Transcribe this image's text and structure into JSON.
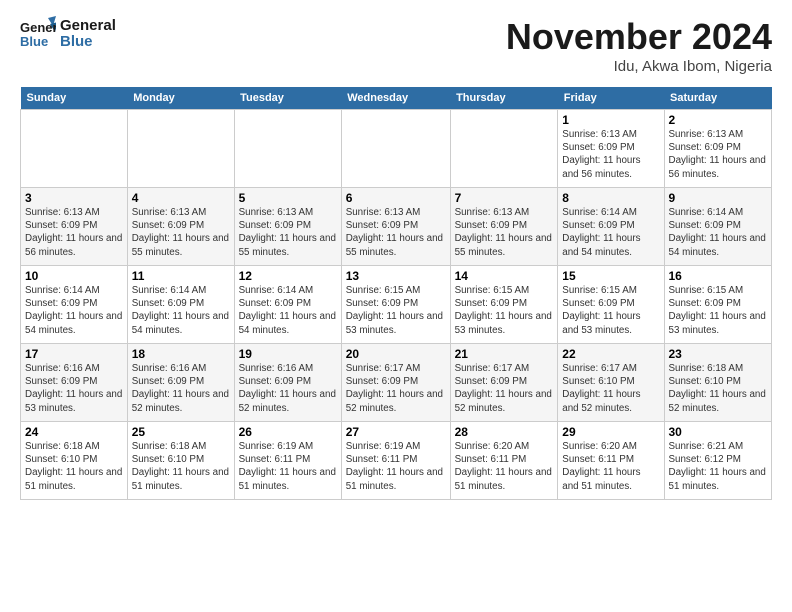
{
  "header": {
    "logo_line1": "General",
    "logo_line2": "Blue",
    "month_title": "November 2024",
    "location": "Idu, Akwa Ibom, Nigeria"
  },
  "days_of_week": [
    "Sunday",
    "Monday",
    "Tuesday",
    "Wednesday",
    "Thursday",
    "Friday",
    "Saturday"
  ],
  "weeks": [
    [
      {
        "day": "",
        "info": ""
      },
      {
        "day": "",
        "info": ""
      },
      {
        "day": "",
        "info": ""
      },
      {
        "day": "",
        "info": ""
      },
      {
        "day": "",
        "info": ""
      },
      {
        "day": "1",
        "info": "Sunrise: 6:13 AM\nSunset: 6:09 PM\nDaylight: 11 hours and 56 minutes."
      },
      {
        "day": "2",
        "info": "Sunrise: 6:13 AM\nSunset: 6:09 PM\nDaylight: 11 hours and 56 minutes."
      }
    ],
    [
      {
        "day": "3",
        "info": "Sunrise: 6:13 AM\nSunset: 6:09 PM\nDaylight: 11 hours and 56 minutes."
      },
      {
        "day": "4",
        "info": "Sunrise: 6:13 AM\nSunset: 6:09 PM\nDaylight: 11 hours and 55 minutes."
      },
      {
        "day": "5",
        "info": "Sunrise: 6:13 AM\nSunset: 6:09 PM\nDaylight: 11 hours and 55 minutes."
      },
      {
        "day": "6",
        "info": "Sunrise: 6:13 AM\nSunset: 6:09 PM\nDaylight: 11 hours and 55 minutes."
      },
      {
        "day": "7",
        "info": "Sunrise: 6:13 AM\nSunset: 6:09 PM\nDaylight: 11 hours and 55 minutes."
      },
      {
        "day": "8",
        "info": "Sunrise: 6:14 AM\nSunset: 6:09 PM\nDaylight: 11 hours and 54 minutes."
      },
      {
        "day": "9",
        "info": "Sunrise: 6:14 AM\nSunset: 6:09 PM\nDaylight: 11 hours and 54 minutes."
      }
    ],
    [
      {
        "day": "10",
        "info": "Sunrise: 6:14 AM\nSunset: 6:09 PM\nDaylight: 11 hours and 54 minutes."
      },
      {
        "day": "11",
        "info": "Sunrise: 6:14 AM\nSunset: 6:09 PM\nDaylight: 11 hours and 54 minutes."
      },
      {
        "day": "12",
        "info": "Sunrise: 6:14 AM\nSunset: 6:09 PM\nDaylight: 11 hours and 54 minutes."
      },
      {
        "day": "13",
        "info": "Sunrise: 6:15 AM\nSunset: 6:09 PM\nDaylight: 11 hours and 53 minutes."
      },
      {
        "day": "14",
        "info": "Sunrise: 6:15 AM\nSunset: 6:09 PM\nDaylight: 11 hours and 53 minutes."
      },
      {
        "day": "15",
        "info": "Sunrise: 6:15 AM\nSunset: 6:09 PM\nDaylight: 11 hours and 53 minutes."
      },
      {
        "day": "16",
        "info": "Sunrise: 6:15 AM\nSunset: 6:09 PM\nDaylight: 11 hours and 53 minutes."
      }
    ],
    [
      {
        "day": "17",
        "info": "Sunrise: 6:16 AM\nSunset: 6:09 PM\nDaylight: 11 hours and 53 minutes."
      },
      {
        "day": "18",
        "info": "Sunrise: 6:16 AM\nSunset: 6:09 PM\nDaylight: 11 hours and 52 minutes."
      },
      {
        "day": "19",
        "info": "Sunrise: 6:16 AM\nSunset: 6:09 PM\nDaylight: 11 hours and 52 minutes."
      },
      {
        "day": "20",
        "info": "Sunrise: 6:17 AM\nSunset: 6:09 PM\nDaylight: 11 hours and 52 minutes."
      },
      {
        "day": "21",
        "info": "Sunrise: 6:17 AM\nSunset: 6:09 PM\nDaylight: 11 hours and 52 minutes."
      },
      {
        "day": "22",
        "info": "Sunrise: 6:17 AM\nSunset: 6:10 PM\nDaylight: 11 hours and 52 minutes."
      },
      {
        "day": "23",
        "info": "Sunrise: 6:18 AM\nSunset: 6:10 PM\nDaylight: 11 hours and 52 minutes."
      }
    ],
    [
      {
        "day": "24",
        "info": "Sunrise: 6:18 AM\nSunset: 6:10 PM\nDaylight: 11 hours and 51 minutes."
      },
      {
        "day": "25",
        "info": "Sunrise: 6:18 AM\nSunset: 6:10 PM\nDaylight: 11 hours and 51 minutes."
      },
      {
        "day": "26",
        "info": "Sunrise: 6:19 AM\nSunset: 6:11 PM\nDaylight: 11 hours and 51 minutes."
      },
      {
        "day": "27",
        "info": "Sunrise: 6:19 AM\nSunset: 6:11 PM\nDaylight: 11 hours and 51 minutes."
      },
      {
        "day": "28",
        "info": "Sunrise: 6:20 AM\nSunset: 6:11 PM\nDaylight: 11 hours and 51 minutes."
      },
      {
        "day": "29",
        "info": "Sunrise: 6:20 AM\nSunset: 6:11 PM\nDaylight: 11 hours and 51 minutes."
      },
      {
        "day": "30",
        "info": "Sunrise: 6:21 AM\nSunset: 6:12 PM\nDaylight: 11 hours and 51 minutes."
      }
    ]
  ]
}
